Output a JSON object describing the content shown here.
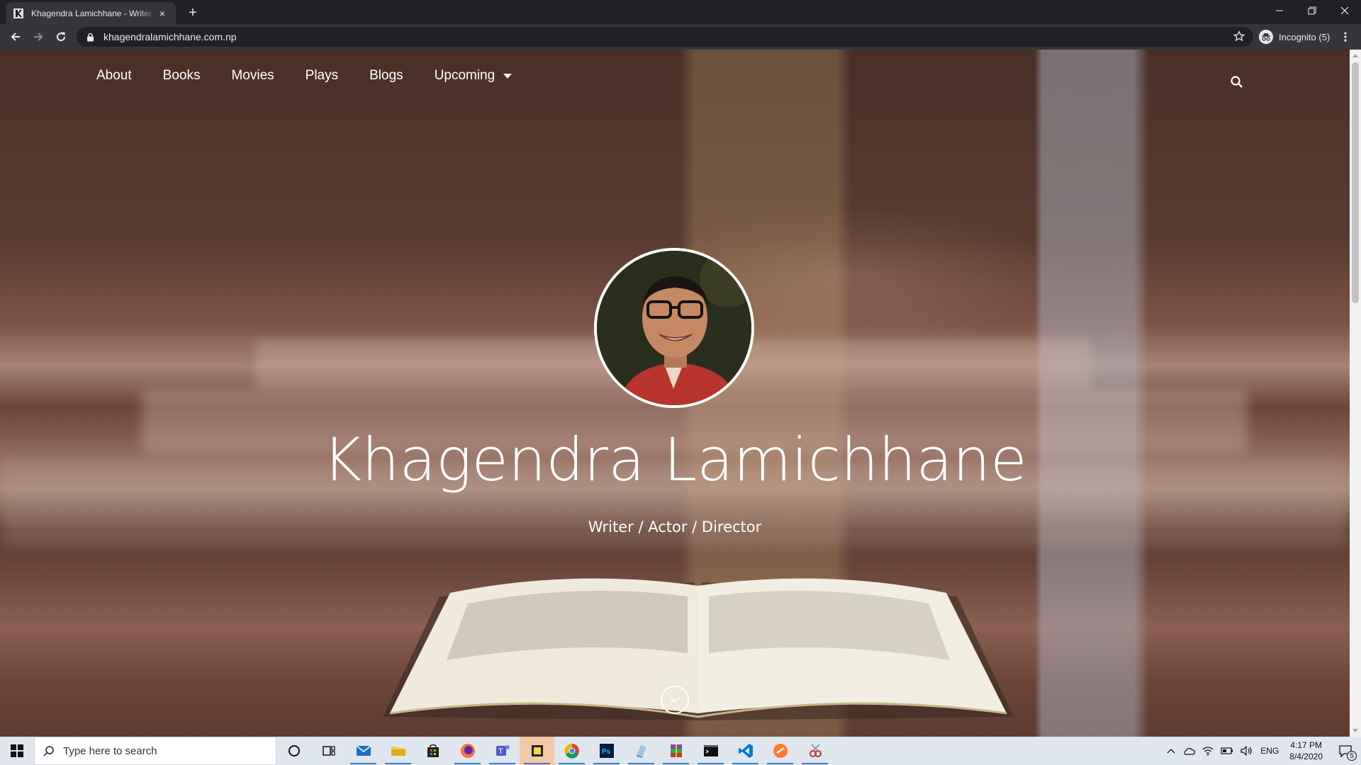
{
  "browser": {
    "tab_title": "Khagendra Lamichhane - Writer / Actor / Director",
    "tab_close": "×",
    "new_tab": "+",
    "url": "khagendralamichhane.com.np",
    "incognito_label": "Incognito (5)"
  },
  "site": {
    "nav": {
      "about": "About",
      "books": "Books",
      "movies": "Movies",
      "plays": "Plays",
      "blogs": "Blogs",
      "upcoming": "Upcoming"
    },
    "hero": {
      "name": "Khagendra Lamichhane",
      "subtitle": "Writer / Actor / Director"
    }
  },
  "taskbar": {
    "search_placeholder": "Type here to search",
    "language": "ENG",
    "time": "4:17 PM",
    "date": "8/4/2020",
    "notification_count": "5",
    "apps": [
      "cortana-icon",
      "task-view-icon",
      "mail-icon",
      "file-explorer-icon",
      "store-icon",
      "firefox-icon",
      "teams-icon",
      "sticky-notes-icon",
      "chrome-icon",
      "photoshop-icon",
      "notepad-icon",
      "winrar-icon",
      "terminal-icon",
      "vscode-icon",
      "sublime-icon",
      "snipping-tool-icon"
    ]
  },
  "colors": {
    "browser_dark": "#202124",
    "browser_toolbar": "#35363a",
    "taskbar": "#dfe6ee",
    "accent": "#3b7fd1"
  }
}
